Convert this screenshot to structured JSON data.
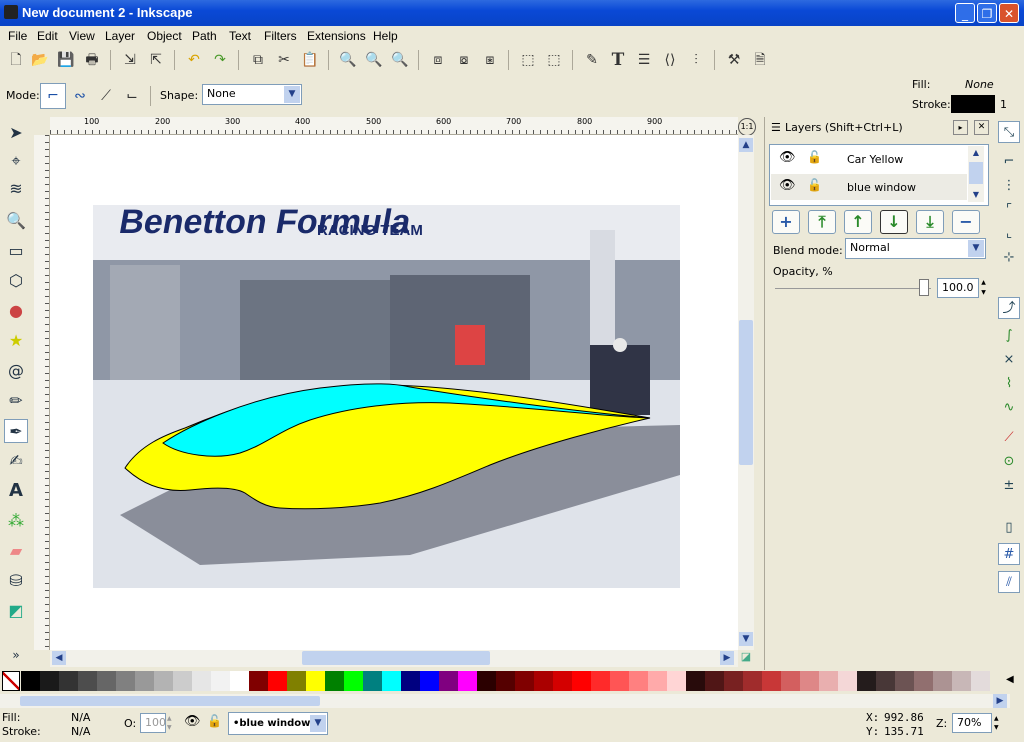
{
  "window": {
    "title": "New document 2 - Inkscape"
  },
  "menu": [
    "File",
    "Edit",
    "View",
    "Layer",
    "Object",
    "Path",
    "Text",
    "Filters",
    "Extensions",
    "Help"
  ],
  "toolcontrols": {
    "mode_label": "Mode:",
    "shape_label": "Shape:",
    "shape_value": "None"
  },
  "style_indicator": {
    "fill_label": "Fill:",
    "fill_value": "None",
    "stroke_label": "Stroke:",
    "stroke_width": "1"
  },
  "ruler_ticks": [
    "100",
    "200",
    "300",
    "400",
    "500",
    "600",
    "700",
    "800",
    "900"
  ],
  "layers_panel": {
    "title": "Layers (Shift+Ctrl+L)",
    "layers": [
      {
        "name": "Car Yellow",
        "selected": false
      },
      {
        "name": "blue window",
        "selected": true
      }
    ],
    "blend_label": "Blend mode:",
    "blend_value": "Normal",
    "opacity_label": "Opacity, %",
    "opacity_value": "100.0"
  },
  "image_text": {
    "banner_top": "Benetton Formula",
    "banner_sub": "RACING TEAM"
  },
  "statusbar": {
    "fill_label": "Fill:",
    "fill_value": "N/A",
    "stroke_label": "Stroke:",
    "stroke_value": "N/A",
    "opacity_label": "O:",
    "opacity_value": "100",
    "current_layer": "•blue window",
    "x_label": "X:",
    "x_value": "992.86",
    "y_label": "Y:",
    "y_value": "135.71",
    "zoom_label": "Z:",
    "zoom_value": "70%"
  },
  "colors": {
    "palette": [
      "#000000",
      "#1a1a1a",
      "#333333",
      "#4d4d4d",
      "#666666",
      "#808080",
      "#999999",
      "#b3b3b3",
      "#cccccc",
      "#e6e6e6",
      "#f2f2f2",
      "#ffffff",
      "#800000",
      "#ff0000",
      "#808000",
      "#ffff00",
      "#008000",
      "#00ff00",
      "#008080",
      "#00ffff",
      "#000080",
      "#0000ff",
      "#800080",
      "#ff00ff",
      "#2b0000",
      "#550000",
      "#800000",
      "#aa0000",
      "#d40000",
      "#ff0000",
      "#ff2a2a",
      "#ff5555",
      "#ff8080",
      "#ffaaaa",
      "#ffd5d5",
      "#280b0b",
      "#501616",
      "#782121",
      "#a02c2c",
      "#c83737",
      "#d35f5f",
      "#de8787",
      "#e9afaf",
      "#f4d7d7",
      "#241c1c",
      "#483737",
      "#6c5353",
      "#916f6f",
      "#ac9393",
      "#c8b7b7",
      "#e3dbdb"
    ],
    "car_yellow": "#ffff00",
    "car_window": "#00ffff",
    "titlebar": "#0a49d6"
  }
}
